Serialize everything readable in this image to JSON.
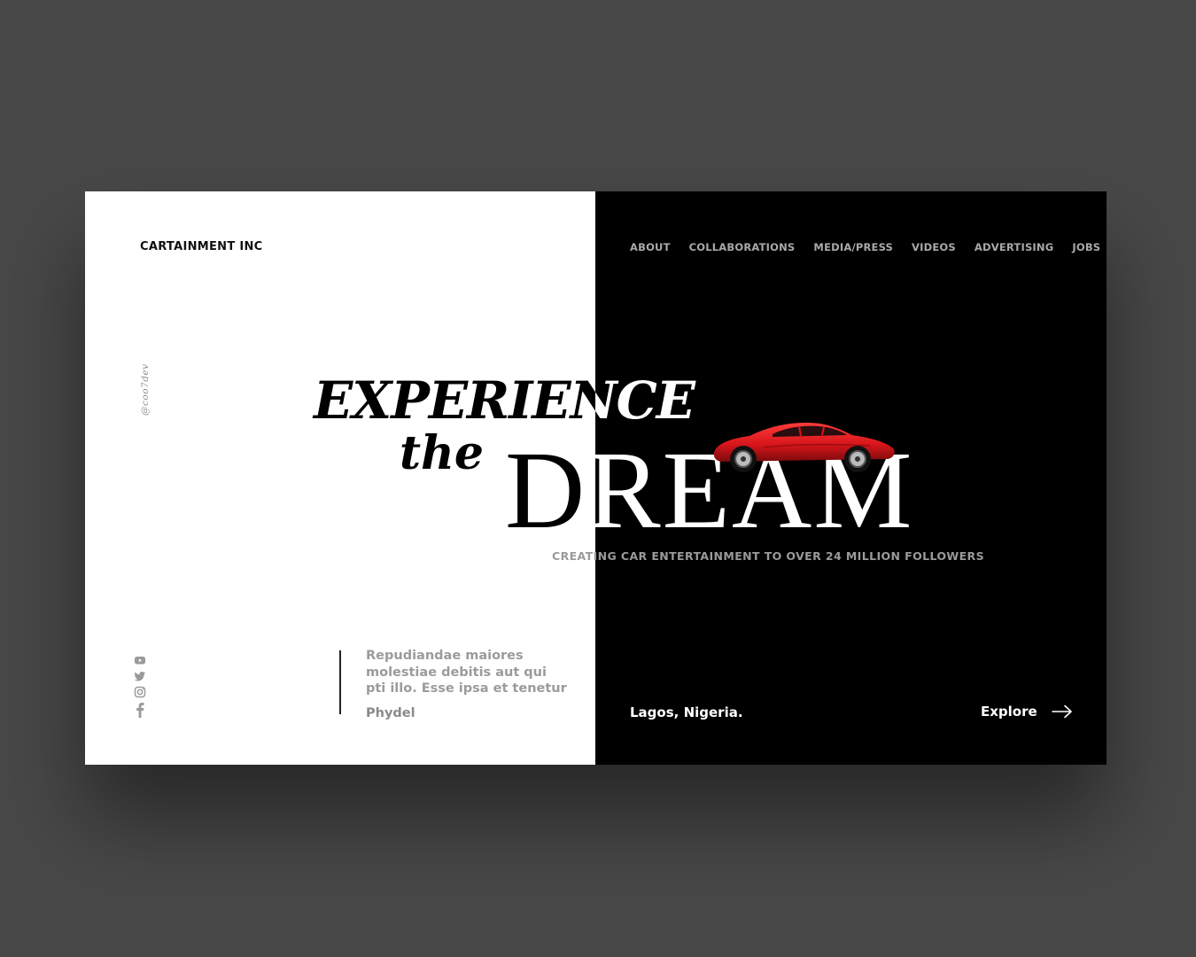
{
  "brand": "CARTAINMENT INC",
  "nav": [
    "ABOUT",
    "COLLABORATIONS",
    "MEDIA/PRESS",
    "VIDEOS",
    "ADVERTISING",
    "JOBS"
  ],
  "handle": "@coo7dev",
  "hero": {
    "line1": "EXPERIENCE",
    "line2": "the",
    "line3_dark": "D",
    "line3_light": "REAM",
    "tagline": "CREATING CAR ENTERTAINMENT TO OVER 24 MILLION FOLLOWERS"
  },
  "socials": [
    "youtube-icon",
    "twitter-icon",
    "instagram-icon",
    "facebook-icon"
  ],
  "quote": {
    "text": "Repudiandae maiores molestiae debitis aut qui pti illo. Esse ipsa et tenetur",
    "author": "Phydel"
  },
  "location": "Lagos, Nigeria.",
  "cta": "Explore",
  "colors": {
    "page_bg": "#484848",
    "dark": "#000000",
    "light": "#ffffff",
    "car": "#d8161b"
  }
}
